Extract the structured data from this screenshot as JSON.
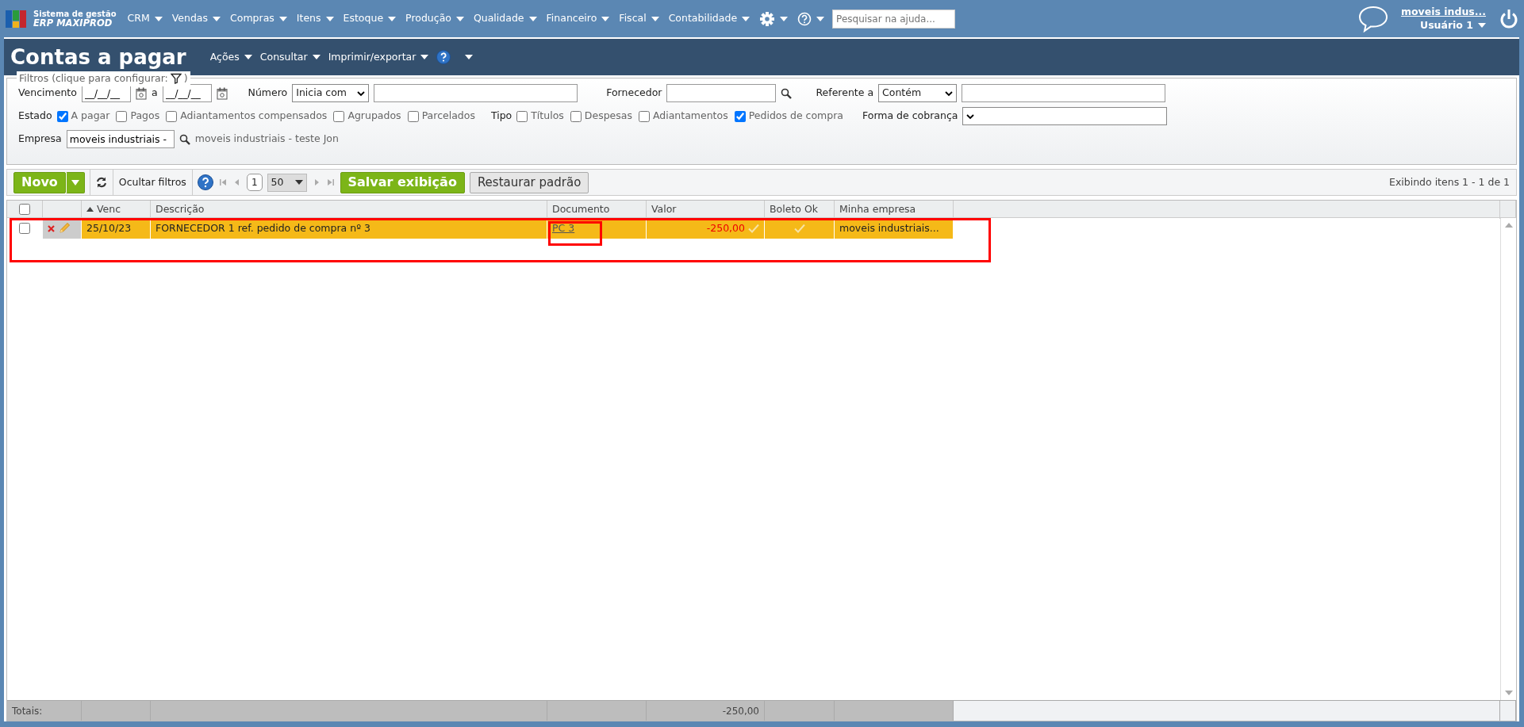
{
  "app": {
    "logo_line1": "Sistema de gestão",
    "logo_line2": "ERP MAXIPROD"
  },
  "menu": [
    "CRM",
    "Vendas",
    "Compras",
    "Itens",
    "Estoque",
    "Produção",
    "Qualidade",
    "Financeiro",
    "Fiscal",
    "Contabilidade"
  ],
  "help_search": {
    "placeholder": "Pesquisar na ajuda..."
  },
  "user": {
    "company": "moveis indus...",
    "name": "Usuário 1"
  },
  "page": {
    "title": "Contas a pagar",
    "menus": [
      "Ações",
      "Consultar",
      "Imprimir/exportar"
    ]
  },
  "filters": {
    "legend": "Filtros (clique para configurar:",
    "legend_end": ")",
    "vencimento": {
      "label": "Vencimento",
      "from": "__/__/__",
      "separator": "a",
      "to": "__/__/__"
    },
    "numero": {
      "label": "Número",
      "mode": "Inicia com"
    },
    "fornecedor": {
      "label": "Fornecedor"
    },
    "referente": {
      "label": "Referente a",
      "mode": "Contém"
    },
    "estado": {
      "label": "Estado",
      "options": [
        {
          "label": "A pagar",
          "checked": true
        },
        {
          "label": "Pagos",
          "checked": false
        },
        {
          "label": "Adiantamentos compensados",
          "checked": false
        },
        {
          "label": "Agrupados",
          "checked": false
        },
        {
          "label": "Parcelados",
          "checked": false
        }
      ]
    },
    "tipo": {
      "label": "Tipo",
      "options": [
        {
          "label": "Títulos",
          "checked": false
        },
        {
          "label": "Despesas",
          "checked": false
        },
        {
          "label": "Adiantamentos",
          "checked": false
        },
        {
          "label": "Pedidos de compra",
          "checked": true
        }
      ]
    },
    "forma": {
      "label": "Forma de cobrança"
    },
    "empresa": {
      "label": "Empresa",
      "value": "moveis industriais -",
      "description": "moveis industriais - teste Jon"
    }
  },
  "toolbar": {
    "new": "Novo",
    "hide_filters": "Ocultar filtros",
    "page": "1",
    "page_size": "50",
    "save": "Salvar exibição",
    "restore": "Restaurar padrão",
    "info": "Exibindo itens 1 - 1 de 1"
  },
  "table": {
    "select_all_checked": false,
    "columns": [
      {
        "label": "Venc",
        "sorted": true
      },
      {
        "label": "Descrição",
        "sorted": false
      },
      {
        "label": "Documento",
        "sorted": false
      },
      {
        "label": "Valor",
        "sorted": false
      },
      {
        "label": "Boleto Ok",
        "sorted": false
      },
      {
        "label": "Minha empresa",
        "sorted": false
      }
    ],
    "rows": [
      {
        "checked": false,
        "highlighted": true,
        "venc": "25/10/23",
        "descricao": "FORNECEDOR 1 ref. pedido de compra nº 3",
        "documento": "PC 3",
        "valor": "-250,00",
        "boleto_ok": true,
        "empresa": "moveis industriais..."
      }
    ],
    "totals": {
      "label": "Totais:",
      "valor": "-250,00"
    }
  }
}
